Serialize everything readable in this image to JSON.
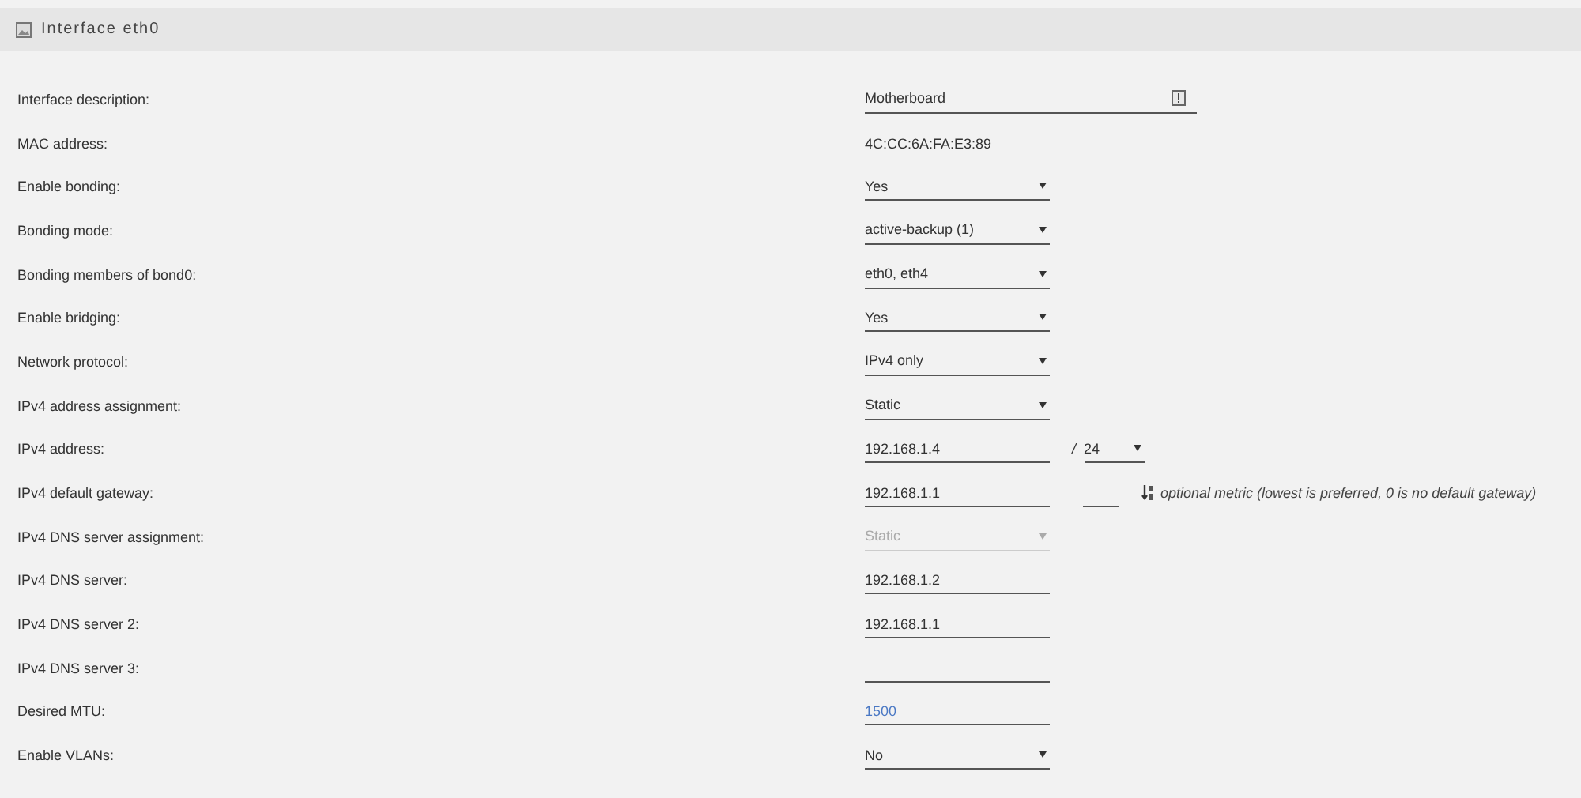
{
  "panel": {
    "title": "Interface eth0"
  },
  "rows": [
    {
      "label": "Interface description:",
      "kind": "text",
      "value": "Motherboard",
      "icon": true
    },
    {
      "label": "MAC address:",
      "kind": "static",
      "value": "4C:CC:6A:FA:E3:89"
    },
    {
      "label": "Enable bonding:",
      "kind": "select",
      "value": "Yes",
      "disabled": false
    },
    {
      "label": "Bonding mode:",
      "kind": "select",
      "value": "active-backup (1)",
      "disabled": false
    },
    {
      "label": "Bonding members of bond0:",
      "kind": "select",
      "value": "eth0, eth4",
      "disabled": false
    },
    {
      "label": "Enable bridging:",
      "kind": "select",
      "value": "Yes",
      "disabled": false
    },
    {
      "label": "Network protocol:",
      "kind": "select",
      "value": "IPv4 only",
      "disabled": false
    },
    {
      "label": "IPv4 address assignment:",
      "kind": "select",
      "value": "Static",
      "disabled": false
    },
    {
      "label": "IPv4 address:",
      "kind": "address",
      "value": "192.168.1.4",
      "separator": "/",
      "prefix": "24"
    },
    {
      "label": "IPv4 default gateway:",
      "kind": "gateway",
      "value": "192.168.1.1",
      "hint": "optional metric (lowest is preferred, 0 is no default gateway)"
    },
    {
      "label": "IPv4 DNS server assignment:",
      "kind": "select",
      "value": "Static",
      "disabled": true
    },
    {
      "label": "IPv4 DNS server:",
      "kind": "text",
      "value": "192.168.1.2"
    },
    {
      "label": "IPv4 DNS server 2:",
      "kind": "text",
      "value": "192.168.1.1"
    },
    {
      "label": "IPv4 DNS server 3:",
      "kind": "text"
    },
    {
      "label": "Desired MTU:",
      "kind": "text",
      "placeholder": "1500"
    },
    {
      "label": "Enable VLANs:",
      "kind": "select",
      "value": "No",
      "disabled": false
    }
  ]
}
